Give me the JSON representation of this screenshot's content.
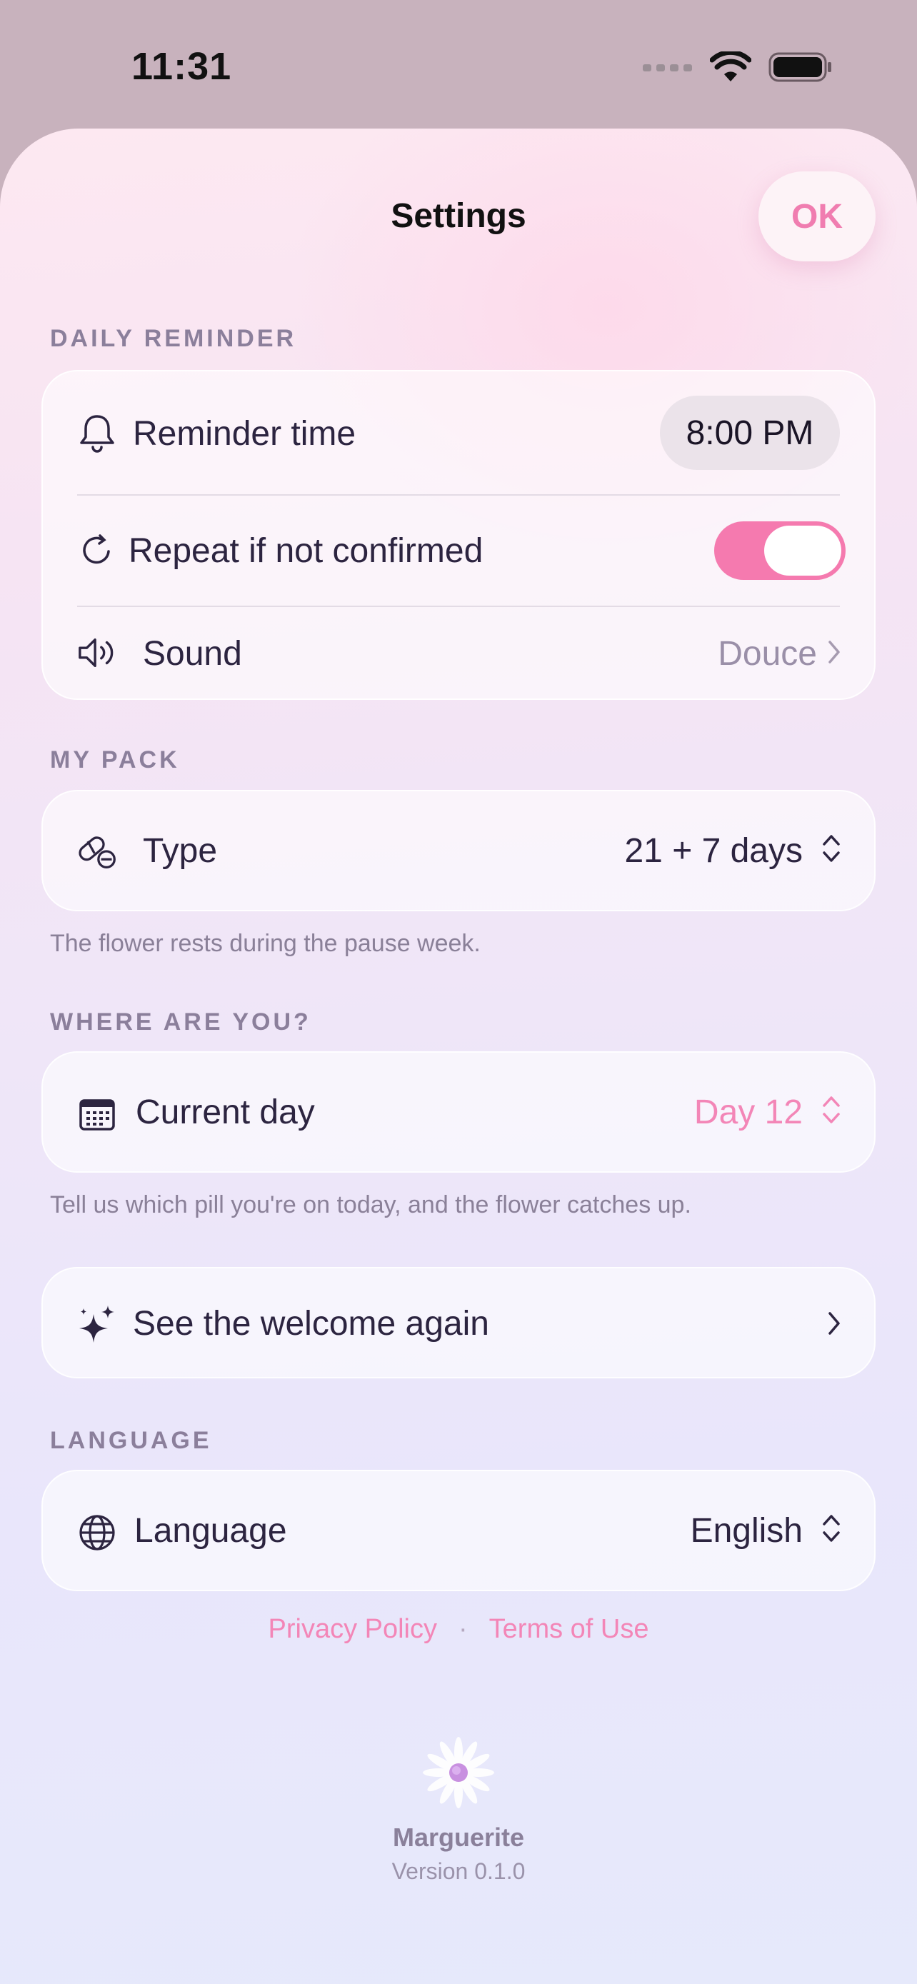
{
  "status_bar": {
    "time": "11:31"
  },
  "header": {
    "title": "Settings",
    "ok_label": "OK"
  },
  "daily_reminder": {
    "section_label": "DAILY REMINDER",
    "reminder_time_label": "Reminder time",
    "reminder_time_value": "8:00 PM",
    "repeat_label": "Repeat if not confirmed",
    "repeat_enabled": true,
    "sound_label": "Sound",
    "sound_value": "Douce"
  },
  "my_pack": {
    "section_label": "MY PACK",
    "type_label": "Type",
    "type_value": "21 + 7 days",
    "footnote": "The flower rests during the pause week."
  },
  "where_are_you": {
    "section_label": "WHERE ARE YOU?",
    "current_day_label": "Current day",
    "current_day_value": "Day 12",
    "footnote": "Tell us which pill you're on today, and the flower catches up."
  },
  "welcome": {
    "label": "See the welcome again"
  },
  "language": {
    "section_label": "LANGUAGE",
    "label": "Language",
    "value": "English"
  },
  "footer": {
    "privacy_label": "Privacy Policy",
    "separator": "·",
    "terms_label": "Terms of Use",
    "app_name": "Marguerite",
    "version": "Version 0.1.0"
  },
  "colors": {
    "accent": "#f57aaf",
    "accent_text": "#f386b7",
    "section_label": "#8b7f9b"
  }
}
